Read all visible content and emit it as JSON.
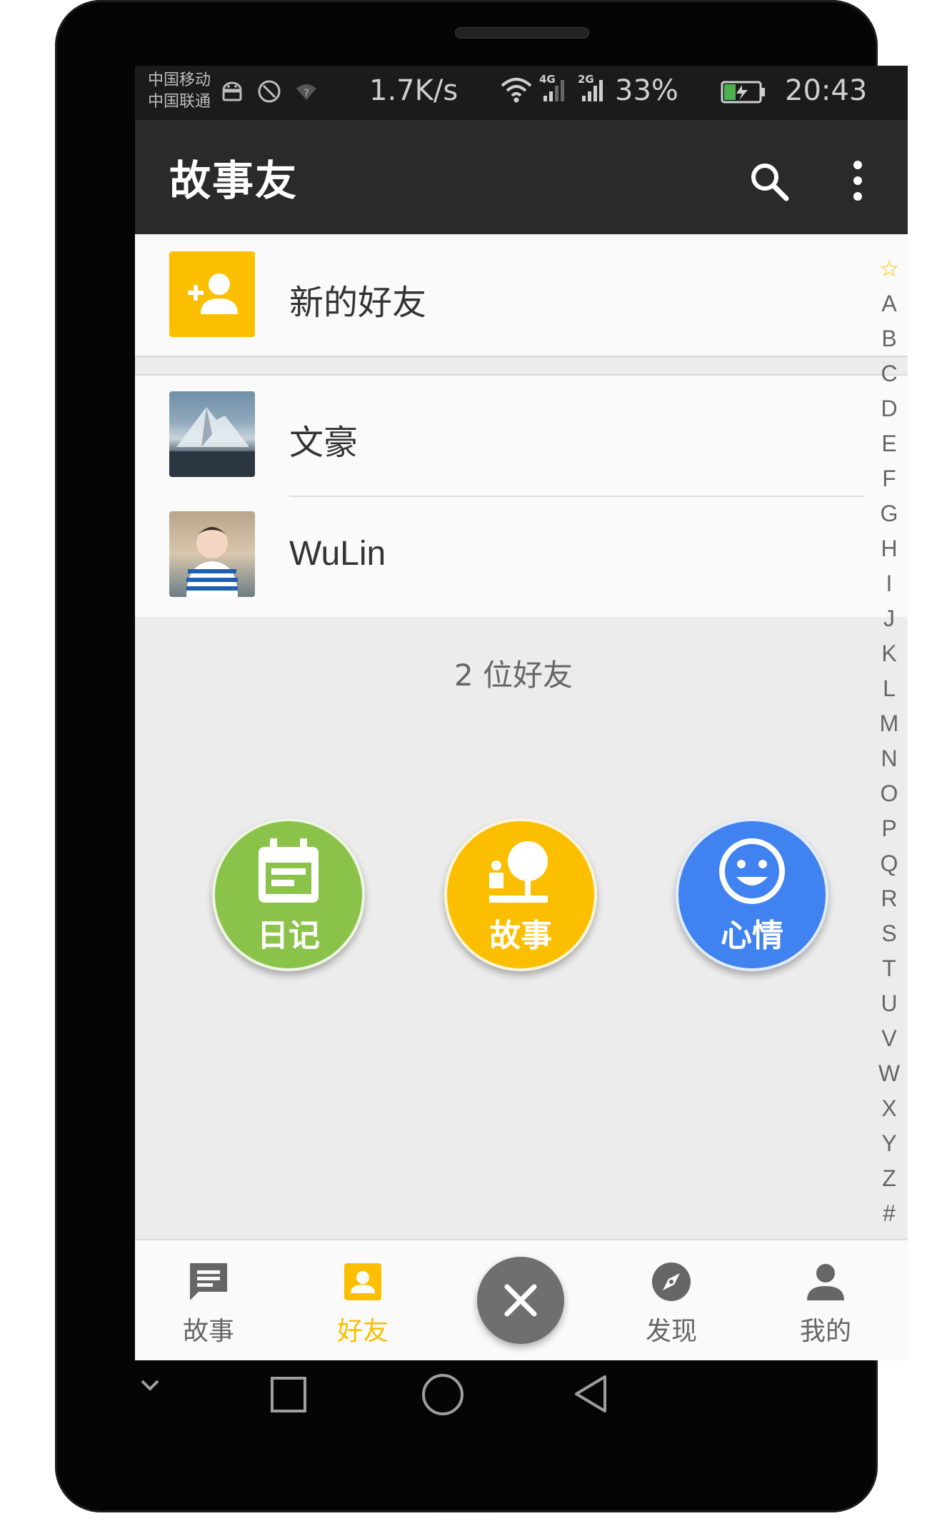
{
  "status_bar": {
    "carrier1": "中国移动",
    "carrier2": "中国联通",
    "speed": "1.7K/s",
    "net1": "4G",
    "net2": "2G",
    "battery": "33%",
    "time": "20:43"
  },
  "app_bar": {
    "title": "故事友",
    "icons": [
      "search-icon",
      "more-vert-icon"
    ]
  },
  "new_friends": {
    "label": "新的好友",
    "icon": "add-person-icon",
    "color": "#fbbf00"
  },
  "friends": [
    {
      "name": "文豪"
    },
    {
      "name": "WuLin"
    }
  ],
  "friend_count": "2 位好友",
  "index_letters": [
    "☆",
    "A",
    "B",
    "C",
    "D",
    "E",
    "F",
    "G",
    "H",
    "I",
    "J",
    "K",
    "L",
    "M",
    "N",
    "O",
    "P",
    "Q",
    "R",
    "S",
    "T",
    "U",
    "V",
    "W",
    "X",
    "Y",
    "Z",
    "#"
  ],
  "actions": [
    {
      "label": "日记",
      "icon": "diary-icon",
      "color": "#8bc34a"
    },
    {
      "label": "故事",
      "icon": "story-icon",
      "color": "#fbbf00"
    },
    {
      "label": "心情",
      "icon": "smiley-icon",
      "color": "#3f82f0"
    }
  ],
  "bottom_nav": {
    "items": [
      {
        "label": "故事",
        "icon": "chat-icon"
      },
      {
        "label": "好友",
        "icon": "contact-icon"
      },
      {
        "label": "发现",
        "icon": "compass-icon"
      },
      {
        "label": "我的",
        "icon": "person-icon"
      }
    ],
    "active": "好友",
    "active_color": "#fbbf00",
    "close_icon": "close-icon"
  }
}
